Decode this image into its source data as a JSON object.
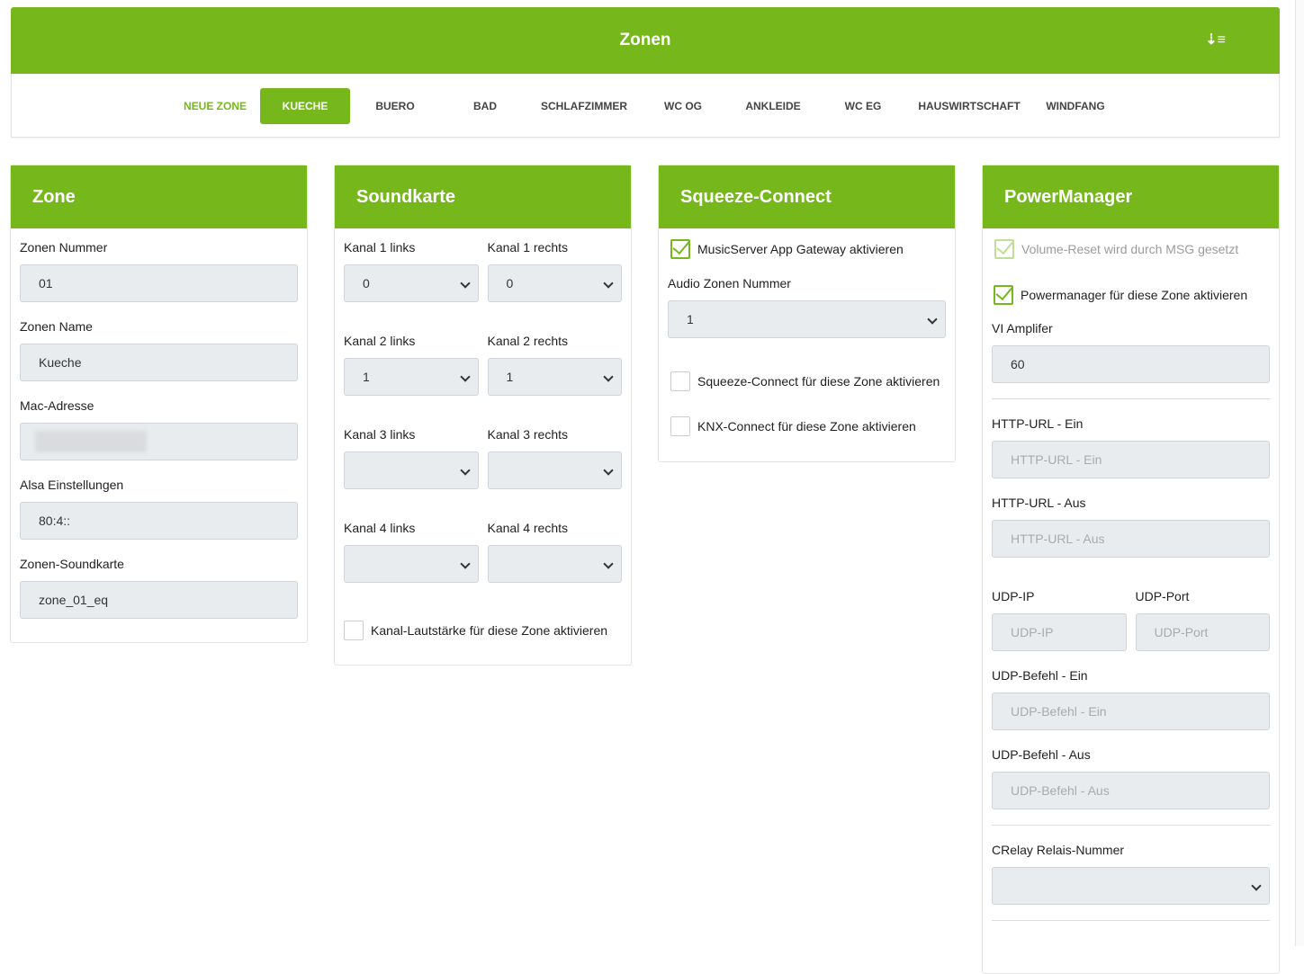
{
  "header": {
    "title": "Zonen",
    "sort_icon": "sort-amount-down-icon"
  },
  "tabs": [
    "NEUE ZONE",
    "KUECHE",
    "BUERO",
    "BAD",
    "SCHLAFZIMMER",
    "WC OG",
    "ANKLEIDE",
    "WC EG",
    "HAUSWIRTSCHAFT",
    "WINDFANG"
  ],
  "active_tab": "KUECHE",
  "zone": {
    "title": "Zone",
    "nummer_label": "Zonen Nummer",
    "nummer": "01",
    "name_label": "Zonen Name",
    "name": "Kueche",
    "mac_label": "Mac-Adresse",
    "alsa_label": "Alsa Einstellungen",
    "alsa": "80:4::",
    "soundkarte_label": "Zonen-Soundkarte",
    "soundkarte": "zone_01_eq"
  },
  "soundkarte": {
    "title": "Soundkarte",
    "k1l": "Kanal 1 links",
    "k1r": "Kanal 1 rechts",
    "k1l_v": "0",
    "k1r_v": "0",
    "k2l": "Kanal 2 links",
    "k2r": "Kanal 2 rechts",
    "k2l_v": "1",
    "k2r_v": "1",
    "k3l": "Kanal 3 links",
    "k3r": "Kanal 3 rechts",
    "k4l": "Kanal 4 links",
    "k4r": "Kanal 4 rechts",
    "volume_cb": "Kanal-Lautstärke für diese Zone aktivieren"
  },
  "squeeze": {
    "title": "Squeeze-Connect",
    "gateway_cb": "MusicServer App Gateway aktivieren",
    "audio_label": "Audio Zonen Nummer",
    "audio_value": "1",
    "squeeze_cb": "Squeeze-Connect für diese Zone aktivieren",
    "knx_cb": "KNX-Connect für diese Zone aktivieren"
  },
  "power": {
    "title": "PowerManager",
    "reset_cb": "Volume-Reset wird durch MSG gesetzt",
    "pm_cb": "Powermanager für diese Zone aktivieren",
    "vi_label": "VI Amplifer",
    "vi_value": "60",
    "http_on_label": "HTTP-URL - Ein",
    "http_on_ph": "HTTP-URL - Ein",
    "http_off_label": "HTTP-URL - Aus",
    "http_off_ph": "HTTP-URL - Aus",
    "udp_ip_label": "UDP-IP",
    "udp_ip_ph": "UDP-IP",
    "udp_port_label": "UDP-Port",
    "udp_port_ph": "UDP-Port",
    "udp_on_label": "UDP-Befehl - Ein",
    "udp_on_ph": "UDP-Befehl - Ein",
    "udp_off_label": "UDP-Befehl - Aus",
    "udp_off_ph": "UDP-Befehl - Aus",
    "crelay_label": "CRelay Relais-Nummer"
  },
  "colors": {
    "accent": "#76b81c"
  }
}
